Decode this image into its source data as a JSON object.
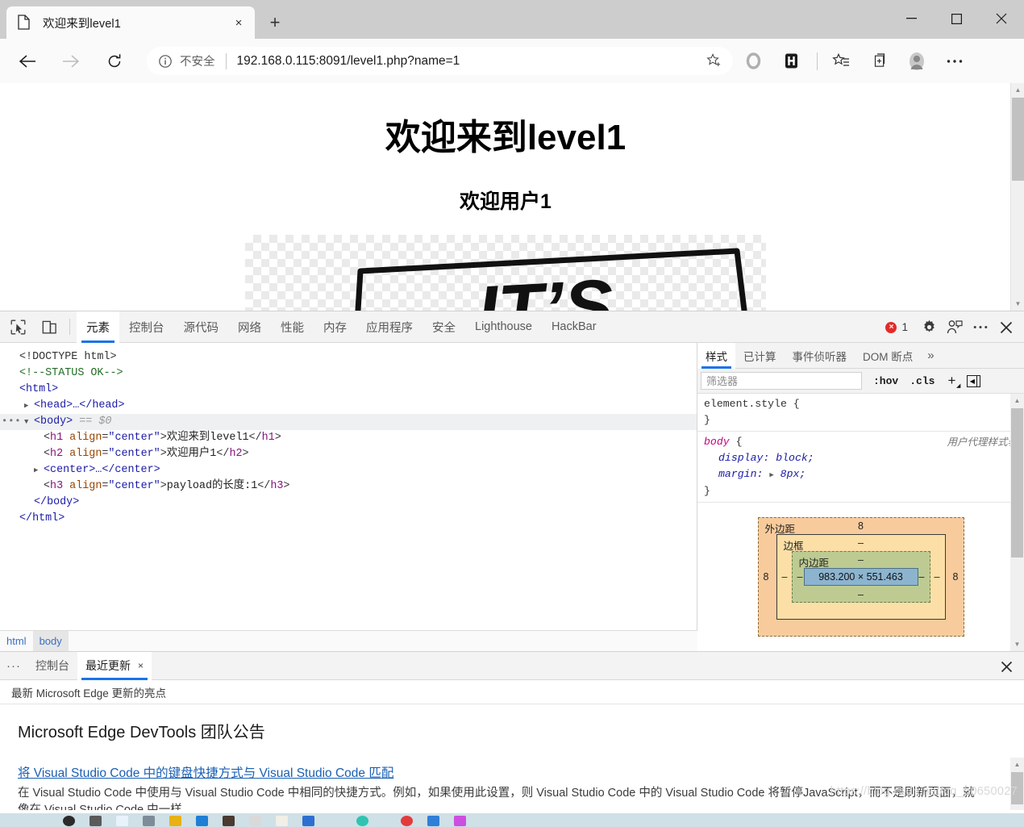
{
  "browser": {
    "tab": {
      "title": "欢迎来到level1",
      "favicon": "page-icon",
      "close_label": "×"
    },
    "new_tab_label": "+",
    "window_controls": {
      "minimize": "minimize-icon",
      "maximize": "maximize-icon",
      "close": "close-icon"
    },
    "nav": {
      "back": "back-arrow-icon",
      "forward": "forward-arrow-icon",
      "reload": "reload-icon"
    },
    "omnibox": {
      "security_label": "不安全",
      "url_host": "192.168.0.115:8091",
      "url_path": "/level1.php?name=1",
      "url_full": "192.168.0.115:8091/level1.php?name=1",
      "favorite_label": "☆"
    },
    "toolbar_icons": [
      "collections-circle-icon",
      "hackbar-icon",
      "favorites-icon",
      "collections-icon",
      "profile-avatar-icon",
      "settings-more-icon"
    ]
  },
  "page": {
    "h1": "欢迎来到level1",
    "h2": "欢迎用户1",
    "image_alt": "IT'S"
  },
  "devtools": {
    "tools": {
      "inspect": "inspect-element-icon",
      "device": "device-toolbar-icon"
    },
    "tabs": [
      {
        "label": "元素",
        "active": true
      },
      {
        "label": "控制台",
        "active": false
      },
      {
        "label": "源代码",
        "active": false
      },
      {
        "label": "网络",
        "active": false
      },
      {
        "label": "性能",
        "active": false
      },
      {
        "label": "内存",
        "active": false
      },
      {
        "label": "应用程序",
        "active": false
      },
      {
        "label": "安全",
        "active": false
      },
      {
        "label": "Lighthouse",
        "active": false
      },
      {
        "label": "HackBar",
        "active": false
      }
    ],
    "error_count": "1",
    "right_icons": [
      "settings-gear-icon",
      "feedback-person-icon",
      "more-options-icon",
      "close-devtools-icon"
    ],
    "dom": {
      "doctype": "<!DOCTYPE html>",
      "status_comment": "<!--STATUS OK-->",
      "html_open": "<html>",
      "head_collapsed": "<head>…</head>",
      "body_open": "<body>",
      "body_marker": "== $0",
      "h1_line_tag": "h1",
      "h1_attr": "align",
      "h1_attr_value": "\"center\"",
      "h1_text": "欢迎来到level1",
      "h2_line_tag": "h2",
      "h2_text": "欢迎用户1",
      "center_collapsed": "<center>…</center>",
      "h3_line_tag": "h3",
      "h3_text": "payload的长度:1",
      "body_close": "</body>",
      "html_close": "</html>"
    },
    "breadcrumbs": [
      {
        "label": "html",
        "selected": false
      },
      {
        "label": "body",
        "selected": true
      }
    ],
    "styles": {
      "tabs": [
        {
          "label": "样式",
          "active": true
        },
        {
          "label": "已计算",
          "active": false
        },
        {
          "label": "事件侦听器",
          "active": false
        },
        {
          "label": "DOM 断点",
          "active": false
        }
      ],
      "more_label": "»",
      "filter_placeholder": "筛选器",
      "filter_value": "",
      "hov_label": ":hov",
      "cls_label": ".cls",
      "plus_label": "+",
      "panel_toggle": "toggle-sidebar-icon",
      "rules": [
        {
          "selector": "element.style",
          "origin": "",
          "props": []
        },
        {
          "selector": "body",
          "origin": "用户代理样式表",
          "props": [
            {
              "name": "display",
              "value": "block;"
            },
            {
              "name": "margin",
              "value": "8px;"
            }
          ]
        }
      ],
      "box_model": {
        "margin_label": "外边距",
        "margin_top": "8",
        "margin_left": "8",
        "margin_right": "8",
        "border_label": "边框",
        "border_top": "–",
        "border_left": "–",
        "border_right": "–",
        "padding_label": "内边距",
        "padding_top": "–",
        "padding_left": "–",
        "padding_right": "–",
        "padding_bottom": "–",
        "content_size": "983.200 × 551.463"
      }
    }
  },
  "drawer": {
    "more_label": "···",
    "tabs": [
      {
        "label": "控制台",
        "active": false,
        "closable": false
      },
      {
        "label": "最近更新",
        "active": true,
        "closable": true
      }
    ],
    "close_tab_label": "×",
    "close_drawer_label": "✕",
    "subtitle": "最新 Microsoft Edge 更新的亮点",
    "announcement": {
      "title": "Microsoft Edge DevTools 团队公告",
      "link": "将 Visual Studio Code 中的键盘快捷方式与 Visual Studio Code 匹配",
      "body": "在 Visual Studio Code 中使用与 Visual Studio Code 中相同的快捷方式。例如，如果使用此设置，则 Visual Studio Code 中的 Visual Studio Code 将暂停JavaScript，而不是刷新页面，就像在 Visual Studio Code 中一样。"
    }
  },
  "watermark": "https://blog.csdn.net/qq_50650027",
  "colors": {
    "accent": "#1a73e8",
    "error": "#e42a2a",
    "link": "#1a5fb4",
    "chrome_bg": "#cdcdcd",
    "toolbar_bg": "#fafafa"
  }
}
